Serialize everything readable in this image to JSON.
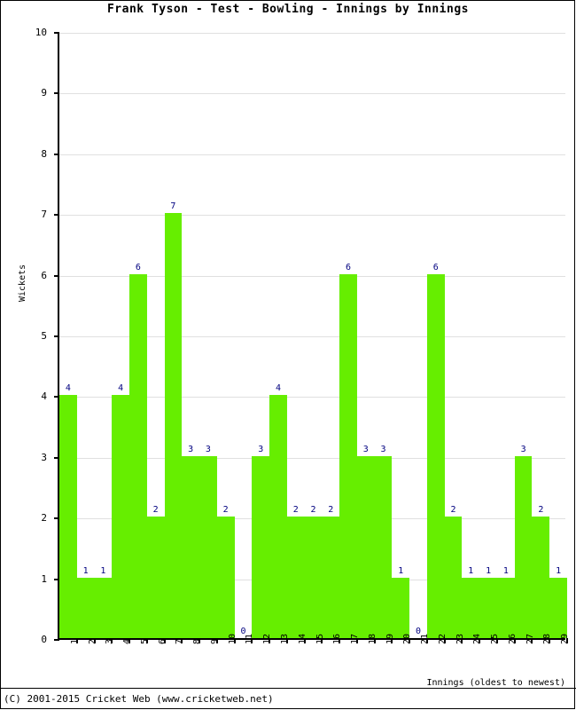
{
  "title": "Frank Tyson - Test - Bowling - Innings by Innings",
  "footer": "(C) 2001-2015 Cricket Web (www.cricketweb.net)",
  "axis": {
    "y_title": "Wickets",
    "x_title": "Innings (oldest to newest)"
  },
  "colors": {
    "bar": "#66ee00",
    "label": "#000080",
    "grid": "#e0e0e0",
    "axis": "#000000"
  },
  "chart_data": {
    "type": "bar",
    "title": "Frank Tyson - Test - Bowling - Innings by Innings",
    "xlabel": "Innings (oldest to newest)",
    "ylabel": "Wickets",
    "ylim": [
      0,
      10
    ],
    "yticks": [
      0,
      1,
      2,
      3,
      4,
      5,
      6,
      7,
      8,
      9,
      10
    ],
    "grid": true,
    "legend": "none",
    "categories": [
      "1",
      "2",
      "3",
      "4",
      "5",
      "6",
      "7",
      "8",
      "9",
      "10",
      "11",
      "12",
      "13",
      "14",
      "15",
      "16",
      "17",
      "18",
      "19",
      "20",
      "21",
      "22",
      "23",
      "24",
      "25",
      "26",
      "27",
      "28",
      "29"
    ],
    "values": [
      4,
      1,
      1,
      4,
      6,
      2,
      7,
      3,
      3,
      2,
      0,
      3,
      4,
      2,
      2,
      2,
      6,
      3,
      3,
      1,
      0,
      6,
      2,
      1,
      1,
      1,
      3,
      2,
      1
    ]
  }
}
